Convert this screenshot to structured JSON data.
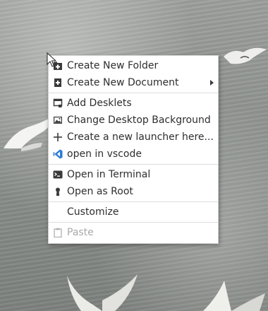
{
  "context_menu": {
    "items": [
      {
        "label": "Create New Folder",
        "icon": "folder-add-icon"
      },
      {
        "label": "Create New Document",
        "icon": "document-add-icon",
        "submenu": true
      },
      {
        "label": "Add Desklets",
        "icon": "desklet-icon"
      },
      {
        "label": "Change Desktop Background",
        "icon": "image-icon"
      },
      {
        "label": "Create a new launcher here...",
        "icon": "plus-icon"
      },
      {
        "label": "open in vscode",
        "icon": "vscode-icon"
      },
      {
        "label": "Open in Terminal",
        "icon": "terminal-icon"
      },
      {
        "label": "Open as Root",
        "icon": "keyhole-icon"
      },
      {
        "label": "Customize",
        "icon": null
      },
      {
        "label": "Paste",
        "icon": "clipboard-icon",
        "disabled": true
      }
    ]
  },
  "colors": {
    "menu_bg": "#ffffff",
    "text": "#2e2e2e",
    "disabled_text": "#a9a9a9",
    "vscode_blue": "#2c7bd8"
  }
}
